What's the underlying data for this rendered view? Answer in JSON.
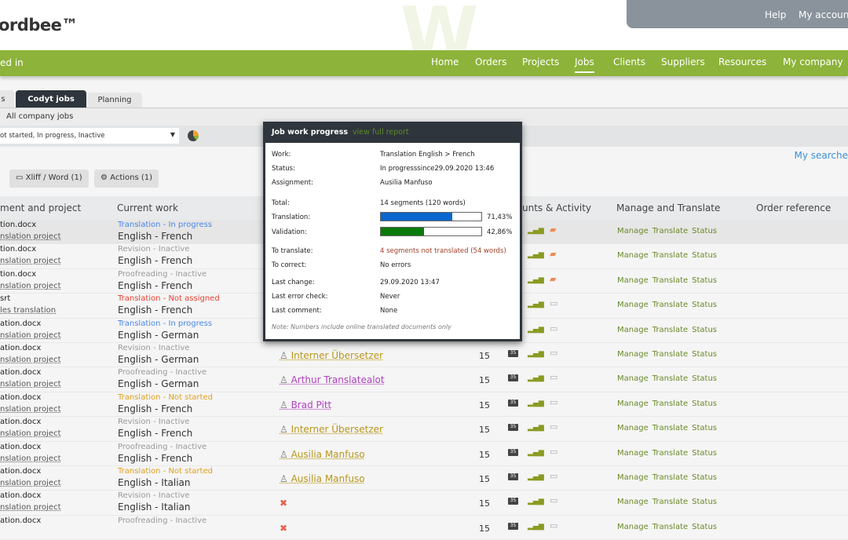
{
  "header": {
    "logo": "ordbee™",
    "help": "Help",
    "account": "My accoun"
  },
  "nav": {
    "logged": "ed in",
    "items": [
      "Home",
      "Orders",
      "Projects",
      "Jobs",
      "Clients",
      "Suppliers",
      "Resources",
      "My company"
    ],
    "active": "Jobs"
  },
  "tabs": [
    {
      "label": "s"
    },
    {
      "label": "Codyt jobs",
      "active": true
    },
    {
      "label": "Planning"
    }
  ],
  "subfilter": "All company jobs",
  "status_filter": "ot started, In progress, Inactive",
  "buttons": {
    "xliff": "Xliff / Word (1)",
    "actions": "Actions (1)"
  },
  "my_searches": "My searche",
  "columns": [
    "ment and project",
    "Current work",
    "unts & Activity",
    "Manage and Translate",
    "Order reference"
  ],
  "row_links": [
    "Manage",
    "Translate",
    "Status"
  ],
  "colors": {
    "green": "#8db33a",
    "dark": "#2f353c",
    "blue_status": "#4a86e8",
    "red_status": "#e84030",
    "orange_status": "#e0a020",
    "grey_status": "#999999"
  },
  "rows": [
    {
      "doc": "tion.docx",
      "project": "nslation project",
      "status": "Translation - In progress",
      "status_color": "#4a86e8",
      "lang": "English - French",
      "assignee": "",
      "count": "",
      "comment": "orange"
    },
    {
      "doc": "tion.docx",
      "project": "nslation project",
      "status": "Revision - Inactive",
      "status_color": "#999",
      "lang": "English - French",
      "assignee": "",
      "count": "",
      "comment": "orange"
    },
    {
      "doc": "tion.docx",
      "project": "nslation project",
      "status": "Proofreading - Inactive",
      "status_color": "#999",
      "lang": "English - French",
      "assignee": "",
      "count": "",
      "comment": "orange"
    },
    {
      "doc": "srt",
      "project": "les translation",
      "status": "Translation - Not assigned",
      "status_color": "#e84030",
      "lang": "English - French",
      "assignee": "",
      "count": "",
      "comment": "grey"
    },
    {
      "doc": "ation.docx",
      "project": "nslation project",
      "status": "Translation - In progress",
      "status_color": "#4a86e8",
      "lang": "English - German",
      "assignee": "",
      "count": "",
      "comment": "grey"
    },
    {
      "doc": "ation.docx",
      "project": "nslation project",
      "status": "Revision - Inactive",
      "status_color": "#999",
      "lang": "English - German",
      "assignee": "Interner Übersetzer",
      "assignee_color": "#b8961a",
      "count": "15",
      "comment": "grey"
    },
    {
      "doc": "ation.docx",
      "project": "nslation project",
      "status": "Proofreading - Inactive",
      "status_color": "#999",
      "lang": "English - German",
      "assignee": "Arthur Translatealot",
      "assignee_color": "#b040c0",
      "count": "15",
      "comment": "grey"
    },
    {
      "doc": "ation.docx",
      "project": "nslation project",
      "status": "Translation - Not started",
      "status_color": "#e0a020",
      "lang": "English - French",
      "assignee": "Brad Pitt",
      "assignee_color": "#b040c0",
      "count": "15",
      "comment": "grey"
    },
    {
      "doc": "ation.docx",
      "project": "nslation project",
      "status": "Revision - Inactive",
      "status_color": "#999",
      "lang": "English - French",
      "assignee": "Interner Übersetzer",
      "assignee_color": "#b8961a",
      "count": "15",
      "comment": "grey"
    },
    {
      "doc": "ation.docx",
      "project": "nslation project",
      "status": "Proofreading - Inactive",
      "status_color": "#999",
      "lang": "English - French",
      "assignee": "Ausilia Manfuso",
      "assignee_color": "#b8961a",
      "count": "15",
      "comment": "grey"
    },
    {
      "doc": "ation.docx",
      "project": "nslation project",
      "status": "Translation - Not started",
      "status_color": "#e0a020",
      "lang": "English - Italian",
      "assignee": "Ausilia Manfuso",
      "assignee_color": "#b8961a",
      "count": "15",
      "comment": "grey"
    },
    {
      "doc": "ation.docx",
      "project": "nslation project",
      "status": "Revision - Inactive",
      "status_color": "#999",
      "lang": "English - Italian",
      "assignee": "",
      "unassigned": true,
      "count": "15",
      "comment": "grey"
    },
    {
      "doc": "ation.docx",
      "project": "",
      "status": "Proofreading - Inactive",
      "status_color": "#999",
      "lang": "",
      "assignee": "",
      "unassigned": true,
      "count": "15",
      "comment": "grey"
    }
  ],
  "popup": {
    "title": "Job work progress",
    "link": "view full report",
    "work_label": "Work:",
    "work": "Translation English > French",
    "status_label": "Status:",
    "status": "In progresssince29.09.2020 13:46",
    "assignment_label": "Assignment:",
    "assignment": "Ausilia Manfuso",
    "total_label": "Total:",
    "total": "14 segments (120 words)",
    "translation_label": "Translation:",
    "translation_pct": "71,43%",
    "translation_fill": 71.43,
    "validation_label": "Validation:",
    "validation_pct": "42,86%",
    "validation_fill": 42.86,
    "to_translate_label": "To translate:",
    "to_translate": "4 segments not translated (54 words)",
    "to_correct_label": "To correct:",
    "to_correct": "No errors",
    "last_change_label": "Last change:",
    "last_change": "29.09.2020 13:47",
    "last_error_label": "Last error check:",
    "last_error": "Never",
    "last_comment_label": "Last comment:",
    "last_comment": "None",
    "note": "Note: Numbers include online translated documents only"
  }
}
